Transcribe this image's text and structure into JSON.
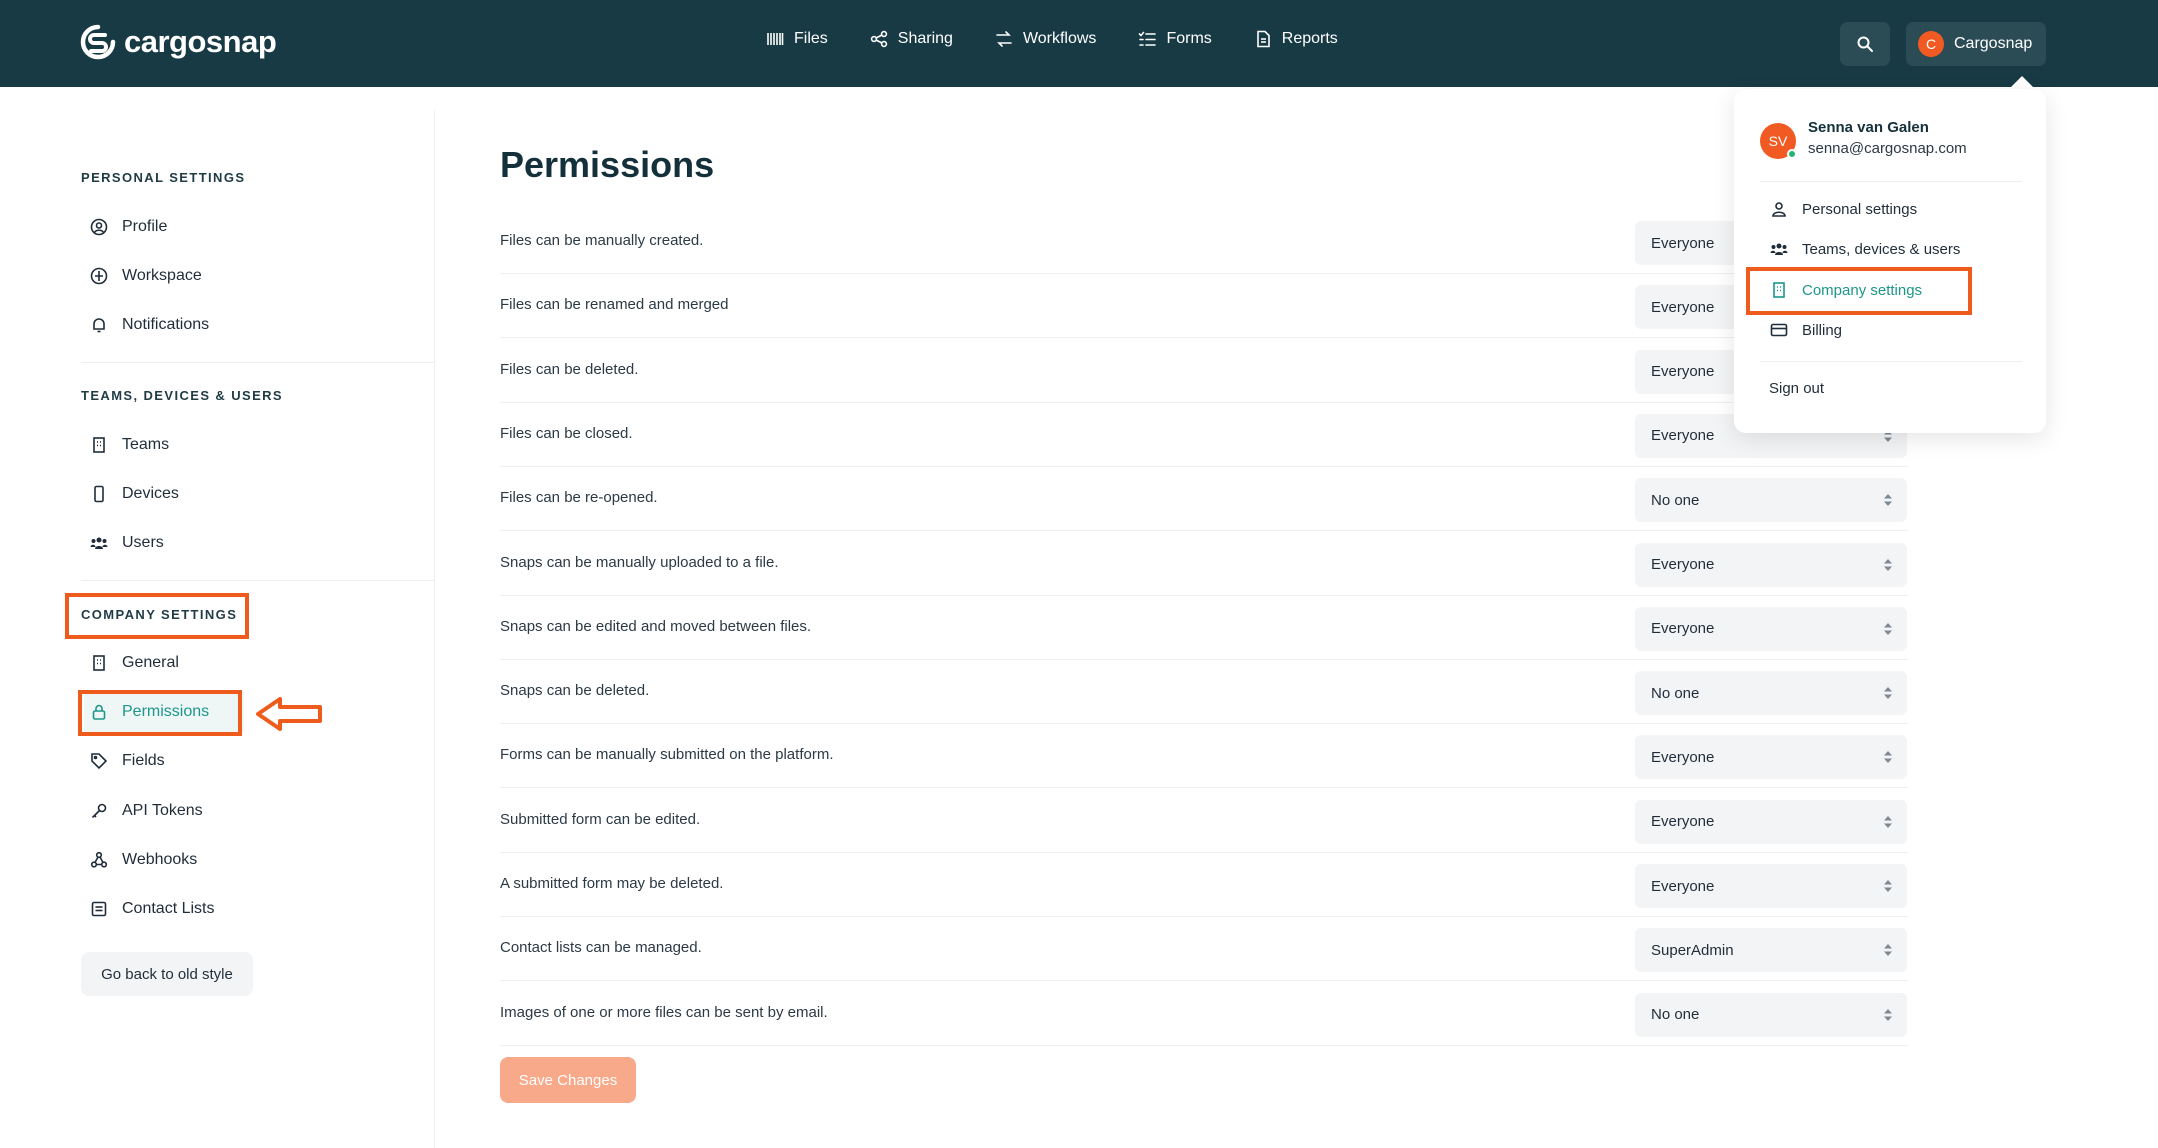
{
  "brand": {
    "name": "cargosnap"
  },
  "nav": [
    {
      "label": "Files",
      "icon": "barcode-icon"
    },
    {
      "label": "Sharing",
      "icon": "share-icon"
    },
    {
      "label": "Workflows",
      "icon": "workflow-icon"
    },
    {
      "label": "Forms",
      "icon": "checklist-icon"
    },
    {
      "label": "Reports",
      "icon": "report-icon"
    }
  ],
  "account": {
    "initial": "C",
    "label": "Cargosnap"
  },
  "sidebar": {
    "personal_title": "PERSONAL SETTINGS",
    "personal": [
      {
        "label": "Profile"
      },
      {
        "label": "Workspace"
      },
      {
        "label": "Notifications"
      }
    ],
    "teams_title": "TEAMS, DEVICES & USERS",
    "teams": [
      {
        "label": "Teams"
      },
      {
        "label": "Devices"
      },
      {
        "label": "Users"
      }
    ],
    "company_title": "COMPANY SETTINGS",
    "company": [
      {
        "label": "General"
      },
      {
        "label": "Permissions"
      },
      {
        "label": "Fields"
      },
      {
        "label": "API Tokens"
      },
      {
        "label": "Webhooks"
      },
      {
        "label": "Contact Lists"
      }
    ],
    "old_style_label": "Go back to old style"
  },
  "page": {
    "title": "Permissions",
    "save_label": "Save Changes",
    "rows": [
      {
        "label": "Files can be manually created.",
        "value": "Everyone"
      },
      {
        "label": "Files can be renamed and merged",
        "value": "Everyone"
      },
      {
        "label": "Files can be deleted.",
        "value": "Everyone"
      },
      {
        "label": "Files can be closed.",
        "value": "Everyone"
      },
      {
        "label": "Files can be re-opened.",
        "value": "No one"
      },
      {
        "label": "Snaps can be manually uploaded to a file.",
        "value": "Everyone"
      },
      {
        "label": "Snaps can be edited and moved between files.",
        "value": "Everyone"
      },
      {
        "label": "Snaps can be deleted.",
        "value": "No one"
      },
      {
        "label": "Forms can be manually submitted on the platform.",
        "value": "Everyone"
      },
      {
        "label": "Submitted form can be edited.",
        "value": "Everyone"
      },
      {
        "label": "A submitted form may be deleted.",
        "value": "Everyone"
      },
      {
        "label": "Contact lists can be managed.",
        "value": "SuperAdmin"
      },
      {
        "label": "Images of one or more files can be sent by email.",
        "value": "No one"
      }
    ]
  },
  "dropdown": {
    "avatar_initials": "SV",
    "user_name": "Senna van Galen",
    "user_email": "senna@cargosnap.com",
    "items": [
      {
        "label": "Personal settings"
      },
      {
        "label": "Teams, devices & users"
      },
      {
        "label": "Company settings"
      },
      {
        "label": "Billing"
      }
    ],
    "sign_out": "Sign out"
  },
  "colors": {
    "topbar": "#173a45",
    "accent_teal": "#1d968a",
    "highlight_orange": "#ef5a1d",
    "save_button": "#f8a98a"
  }
}
